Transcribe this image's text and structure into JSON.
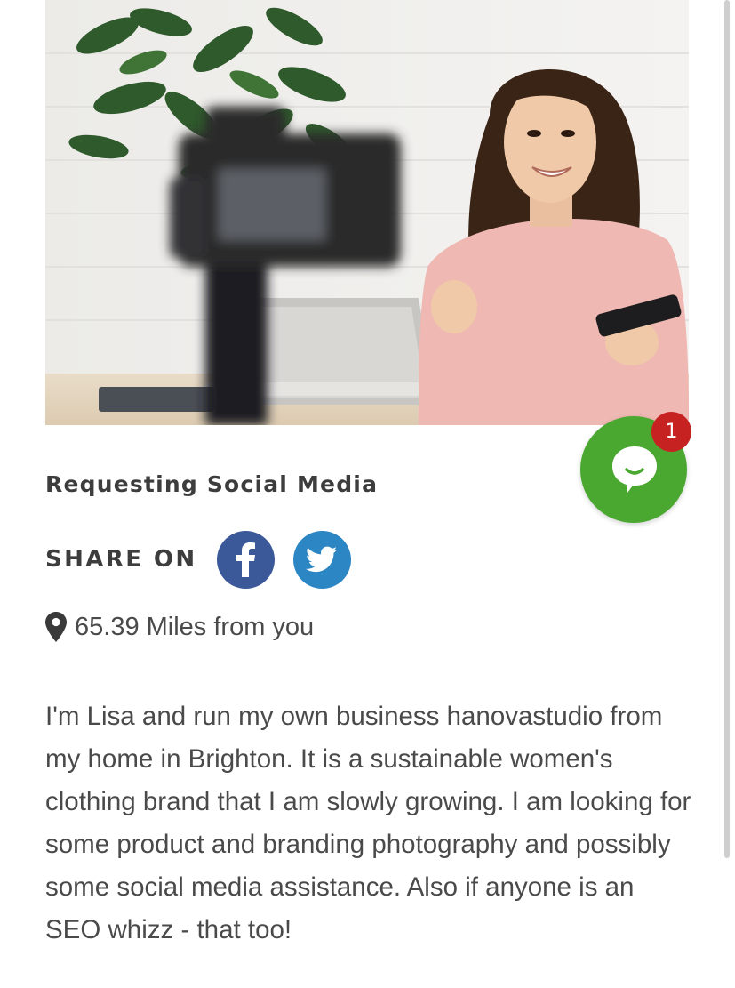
{
  "hero_image": {
    "alt": ""
  },
  "chat": {
    "badge_count": "1",
    "button_color": "#4aa831",
    "badge_color": "#c62222",
    "icon": "chat-bubble-icon"
  },
  "request": {
    "title": "Requesting Social Media"
  },
  "share": {
    "label": "SHARE ON",
    "facebook_color": "#3b5998",
    "twitter_color": "#2d86c4",
    "facebook_icon": "facebook-icon",
    "twitter_icon": "twitter-icon"
  },
  "location": {
    "icon": "map-pin-icon",
    "distance_text": "65.39 Miles from you"
  },
  "description": {
    "text": "I'm Lisa and run my own business hanovastudio from my home in Brighton. It is a sustainable women's clothing brand that I am slowly growing. I am looking for some product and branding photography and possibly some social media assistance. Also if anyone is an SEO whizz - that too!"
  }
}
